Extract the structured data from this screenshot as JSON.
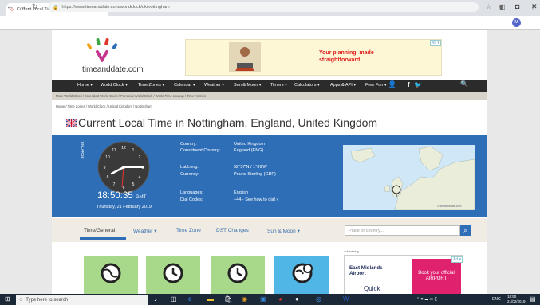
{
  "browser": {
    "tab_title": "Current Local Time in Nottingha",
    "tab_close": "×",
    "new_tab": "+",
    "url": "https://www.timeanddate.com/worldclock/uk/nottingham",
    "win_minimize": "–",
    "win_maximize": "◘",
    "win_close": "✕",
    "account_initial": "M"
  },
  "site": {
    "logo_text": "timeanddate.com",
    "logo_colors": [
      "#f2a31a",
      "#3aa845",
      "#e3322b",
      "#2d6eb6",
      "#c4368c"
    ],
    "ad_text": "Your planning, made straightforward",
    "ad_tag": "Ad ▾"
  },
  "nav": {
    "items": [
      "Home ▾",
      "World Clock ▾",
      "Time Zones ▾",
      "Calendar ▾",
      "Weather ▾",
      "Sun & Moon ▾",
      "Timers ▾",
      "Calculators ▾",
      "Apps & API ▾",
      "Free Fun ▾"
    ],
    "subnav": "Main World Clock / Extended World Clock / Personal World Clock / World Time Lookup / Time Articles"
  },
  "breadcrumb": "Home /  Time Zones /  World Clock /  United Kingdom /  Nottingham",
  "page_title": "Current Local Time in Nottingham, England, United Kingdom",
  "clock": {
    "enlarge": "ENLARGE",
    "time": "18:50:35",
    "tz": "GMT",
    "date": "Thursday, 21 February 2019",
    "numbers": [
      "12",
      "1",
      "2",
      "3",
      "4",
      "5",
      "6",
      "7",
      "8",
      "9",
      "10",
      "11"
    ]
  },
  "info": [
    {
      "label": "Country:",
      "value": "United Kingdom"
    },
    {
      "label": "Constituent Country:",
      "value": "England (ENG)"
    },
    {
      "label": "Lat/Long:",
      "value": "52°57'N / 1°09'W"
    },
    {
      "label": "Currency:",
      "value": "Pound Sterling (GBP)"
    },
    {
      "label": "Languages:",
      "value": "English"
    },
    {
      "label": "Dial Codes:",
      "value": "+44 - See how to dial ›"
    }
  ],
  "map_credit": "© timeanddate.com",
  "tabs": [
    "Time/General",
    "Weather ▾",
    "Time Zone",
    "DST Changes",
    "Sun & Moon ▾"
  ],
  "search_placeholder": "Place or country...",
  "advertising_label": "Advertising",
  "ad_bottom": {
    "logo": "East Midlands Airport",
    "quick": "Quick",
    "book": "Book your official AIRPORT",
    "tag": "Ad ▾"
  },
  "taskbar": {
    "search": "Type here to search",
    "time": "18:50",
    "date": "21/02/2019",
    "lang": "ENG"
  }
}
